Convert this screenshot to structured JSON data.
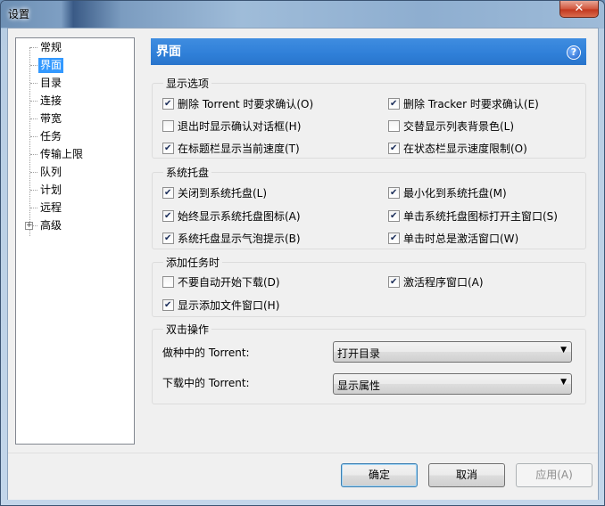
{
  "window": {
    "title": "设置",
    "close_label": "✕"
  },
  "tree": {
    "items": [
      {
        "label": "常规"
      },
      {
        "label": "界面"
      },
      {
        "label": "目录"
      },
      {
        "label": "连接"
      },
      {
        "label": "带宽"
      },
      {
        "label": "任务"
      },
      {
        "label": "传输上限"
      },
      {
        "label": "队列"
      },
      {
        "label": "计划"
      },
      {
        "label": "远程"
      },
      {
        "label": "高级"
      }
    ],
    "selected": "界面",
    "expander": "+"
  },
  "banner": {
    "title": "界面",
    "help_label": "?"
  },
  "display_options": {
    "title": "显示选项",
    "items": [
      {
        "label": "删除 Torrent 时要求确认(O)",
        "checked": true
      },
      {
        "label": "删除 Tracker 时要求确认(E)",
        "checked": true
      },
      {
        "label": "退出时显示确认对话框(H)",
        "checked": false
      },
      {
        "label": "交替显示列表背景色(L)",
        "checked": false
      },
      {
        "label": "在标题栏显示当前速度(T)",
        "checked": true
      },
      {
        "label": "在状态栏显示速度限制(O)",
        "checked": true
      }
    ]
  },
  "tray": {
    "title": "系统托盘",
    "items": [
      {
        "label": "关闭到系统托盘(L)",
        "checked": true
      },
      {
        "label": "最小化到系统托盘(M)",
        "checked": true
      },
      {
        "label": "始终显示系统托盘图标(A)",
        "checked": true
      },
      {
        "label": "单击系统托盘图标打开主窗口(S)",
        "checked": true
      },
      {
        "label": "系统托盘显示气泡提示(B)",
        "checked": true
      },
      {
        "label": "单击时总是激活窗口(W)",
        "checked": true
      }
    ]
  },
  "add_task": {
    "title": "添加任务时",
    "items": [
      {
        "label": "不要自动开始下载(D)",
        "checked": false
      },
      {
        "label": "激活程序窗口(A)",
        "checked": true
      },
      {
        "label": "显示添加文件窗口(H)",
        "checked": true
      }
    ]
  },
  "double_click": {
    "title": "双击操作",
    "seeding_label": "做种中的 Torrent:",
    "seeding_value": "打开目录",
    "downloading_label": "下载中的 Torrent:",
    "downloading_value": "显示属性"
  },
  "buttons": {
    "ok": "确定",
    "cancel": "取消",
    "apply": "应用(A)"
  }
}
